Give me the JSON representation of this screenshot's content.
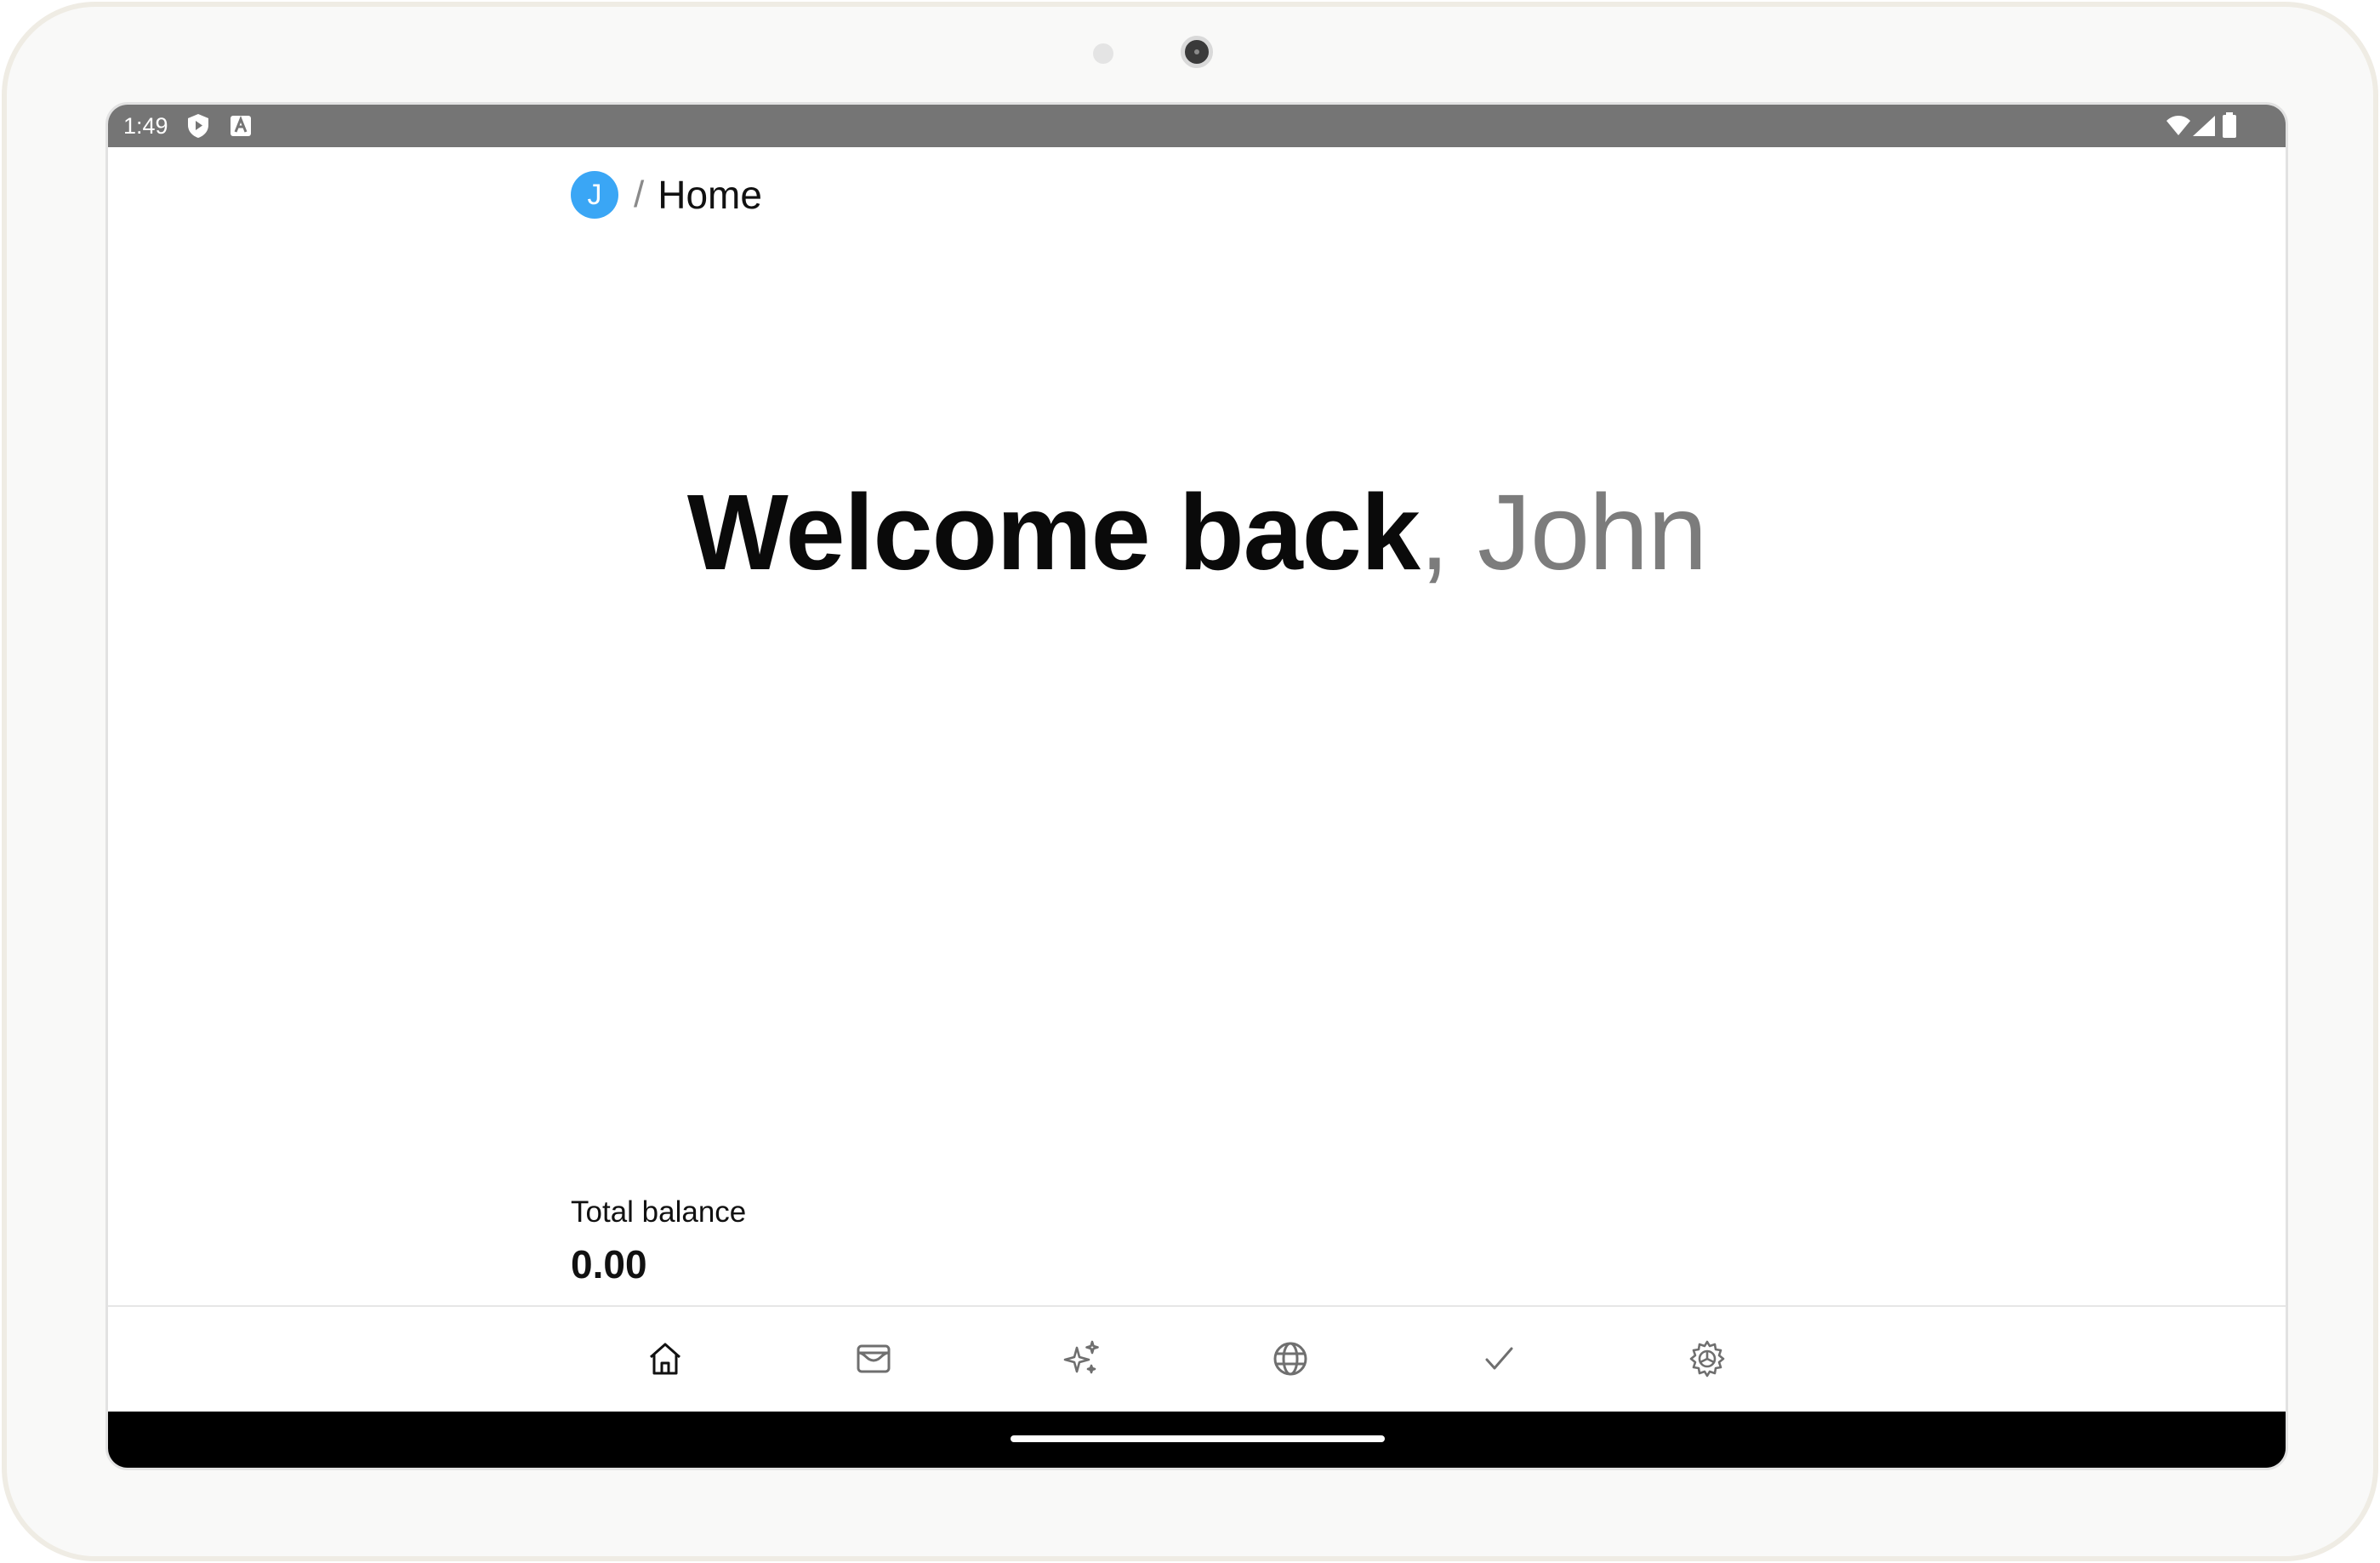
{
  "status_bar": {
    "time": "1:49",
    "left_icons": [
      "shield-play-icon",
      "text-a-icon"
    ],
    "right_icons": [
      "wifi-icon",
      "cellular-signal-icon",
      "battery-icon"
    ]
  },
  "breadcrumb": {
    "avatar_initial": "J",
    "separator": "/",
    "current": "Home"
  },
  "welcome": {
    "greeting": "Welcome back",
    "comma": ",",
    "name": " John"
  },
  "balance": {
    "label": "Total balance",
    "value": "0.00"
  },
  "bottom_nav": [
    {
      "icon": "home-icon",
      "active": true
    },
    {
      "icon": "wallet-icon",
      "active": false
    },
    {
      "icon": "sparkles-icon",
      "active": false
    },
    {
      "icon": "globe-icon",
      "active": false
    },
    {
      "icon": "check-icon",
      "active": false
    },
    {
      "icon": "settings-gear-icon",
      "active": false
    }
  ],
  "colors": {
    "avatar": "#3aa6f5",
    "status_bar": "#757575",
    "secondary_text": "#7c7c7c",
    "nav_active": "#111111",
    "nav_inactive": "#6f6f6f"
  }
}
